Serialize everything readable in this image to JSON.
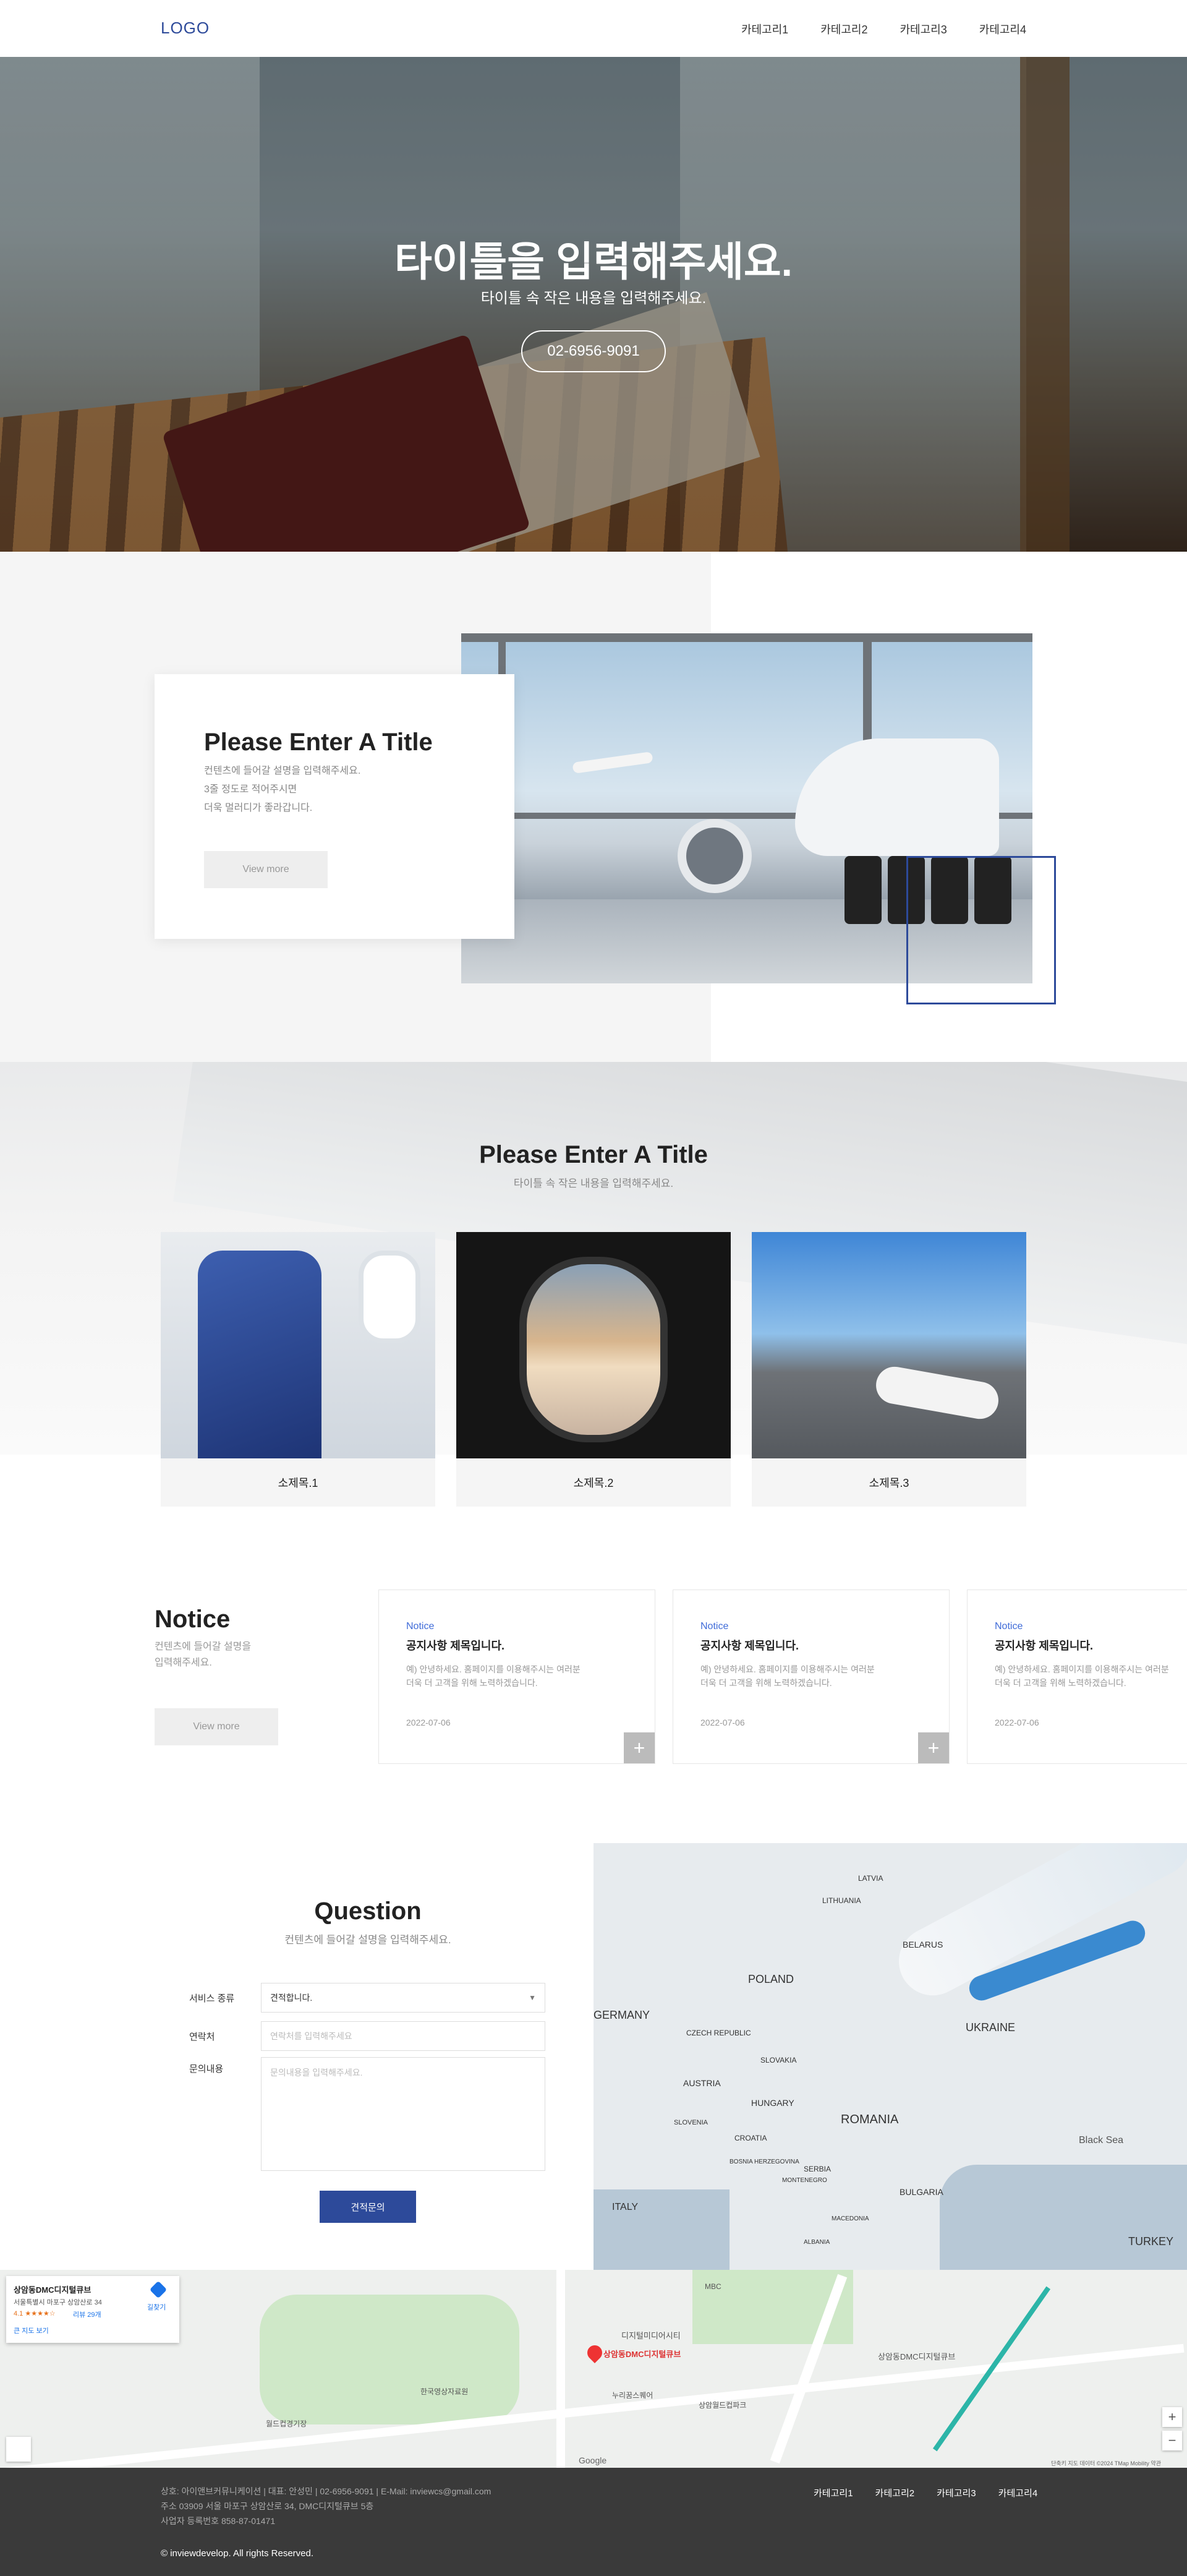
{
  "header": {
    "logo": "LOGO",
    "nav": [
      "카테고리1",
      "카테고리2",
      "카테고리3",
      "카테고리4"
    ]
  },
  "hero": {
    "title": "타이틀을 입력해주세요.",
    "subtitle": "타이틀 속 작은 내용을 입력해주세요.",
    "phone_button": "02-6956-9091"
  },
  "about": {
    "title": "Please Enter A Title",
    "lines": [
      "컨텐츠에 들어갈 설명을 입력해주세요.",
      "3줄 정도로 적어주시면",
      "더욱 멀러디가 좋라갑니다."
    ],
    "button": "View more"
  },
  "gallery": {
    "title": "Please Enter A Title",
    "subtitle": "타이틀 속 작은 내용을 입력해주세요.",
    "items": [
      "소제목.1",
      "소제목.2",
      "소제목.3"
    ]
  },
  "notice": {
    "title": "Notice",
    "desc": [
      "컨텐츠에 들어갈 설명을",
      "입력해주세요."
    ],
    "button": "View more",
    "cards": [
      {
        "tag": "Notice",
        "title": "공지사항 제목입니다.",
        "body": [
          "예) 안녕하세요. 홈페이지를 이용해주시는 여러분",
          "더욱 더 고객을 위해 노력하겠습니다."
        ],
        "date": "2022-07-06",
        "plus": "+"
      },
      {
        "tag": "Notice",
        "title": "공지사항 제목입니다.",
        "body": [
          "예) 안녕하세요. 홈페이지를 이용해주시는 여러분",
          "더욱 더 고객을 위해 노력하겠습니다."
        ],
        "date": "2022-07-06",
        "plus": "+"
      },
      {
        "tag": "Notice",
        "title": "공지사항 제목입니다.",
        "body": [
          "예) 안녕하세요. 홈페이지를 이용해주시는 여러분",
          "더욱 더 고객을 위해 노력하겠습니다."
        ],
        "date": "2022-07-06",
        "plus": "+"
      }
    ]
  },
  "question": {
    "title": "Question",
    "subtitle": "컨텐츠에 들어갈 설명을 입력해주세요.",
    "service_label": "서비스 종류",
    "service_value": "견적합니다.",
    "contact_label": "연락처",
    "contact_placeholder": "연락처를 입력해주세요",
    "content_label": "문의내용",
    "content_placeholder": "문의내용을 입력해주세요.",
    "submit": "견적문의"
  },
  "europe_map_labels": [
    "LATVIA",
    "LITHUANIA",
    "BELARUS",
    "POLAND",
    "GERMANY",
    "CZECH REPUBLIC",
    "SLOVAKIA",
    "UKRAINE",
    "AUSTRIA",
    "HUNGARY",
    "SLOVENIA",
    "CROATIA",
    "ROMANIA",
    "BOSNIA HERZEGOVINA",
    "SERBIA",
    "MONTENEGRO",
    "BULGARIA",
    "ITALY",
    "MACEDONIA",
    "ALBANIA",
    "Black Sea",
    "TURKEY"
  ],
  "location_map": {
    "place_name": "상암동DMC디지털큐브",
    "address": "서울특별시 마포구 상암산로 34",
    "rating": "4.1 ★★★★☆",
    "reviews": "리뷰 29개",
    "directions": "길찾기",
    "larger_map": "큰 지도 보기",
    "pin_label": "상암동DMC디지털큐브",
    "zoom_in": "+",
    "zoom_out": "−",
    "google": "Google",
    "attribution": "단축키 지도 데이터 ©2024 TMap Mobility 약관",
    "labels": [
      "디지털미디어시티",
      "상암동DMC디지털큐브",
      "월드컵경기장",
      "MBC",
      "상암월드컵파크",
      "한국영상자료원",
      "누리꿈스퀘어"
    ]
  },
  "footer": {
    "line1": "상호: 아이앤브커뮤니케이션  |  대표: 안성민  |  02-6956-9091  |  E-Mail: inviewcs@gmail.com",
    "line2": "주소 03909 서울 마포구 상암산로 34, DMC디지털큐브 5층",
    "line3": "사업자 등록번호 858-87-01471",
    "copyright": "© inviewdevelop. All rights Reserved.",
    "nav": [
      "카테고리1",
      "카테고리2",
      "카테고리3",
      "카테고리4"
    ]
  },
  "colors": {
    "accent": "#2d4a9a",
    "notice_tag": "#3f6bd8",
    "footer_bg": "#3a3a3a"
  },
  "icons": [
    "chevron-down-icon",
    "plus-icon",
    "map-pin-icon",
    "directions-icon"
  ]
}
